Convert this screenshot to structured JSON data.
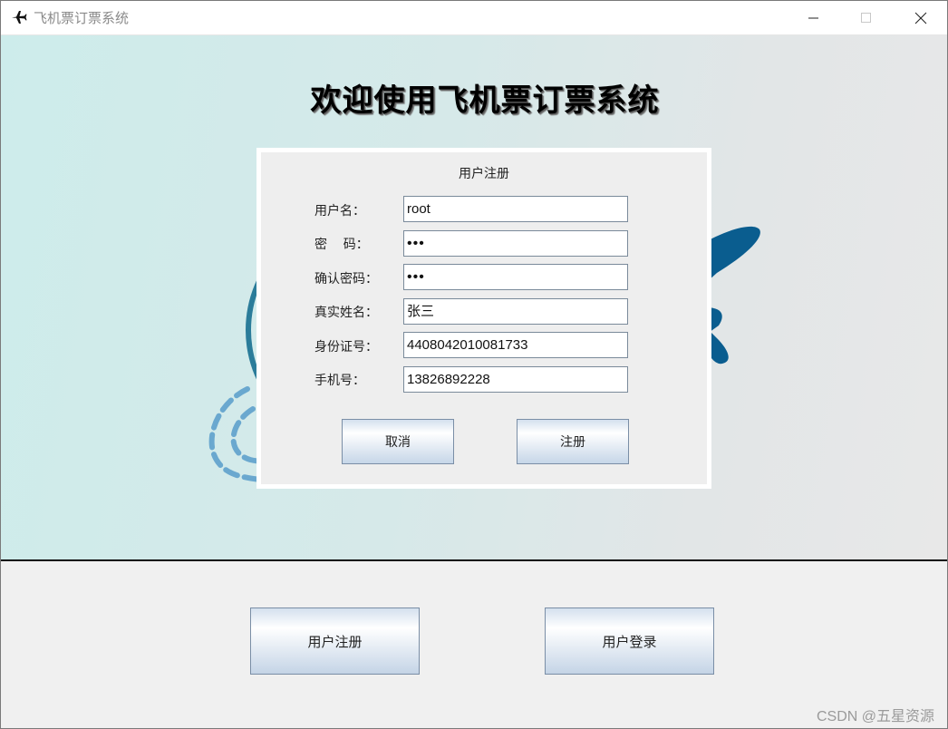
{
  "window": {
    "title": "飞机票订票系统",
    "icon": "airplane-icon"
  },
  "banner": {
    "heading": "欢迎使用飞机票订票系统"
  },
  "register_panel": {
    "title": "用户注册",
    "fields": [
      {
        "label": "用户名：",
        "value": "root"
      },
      {
        "label": "密    码：",
        "value": "•••"
      },
      {
        "label": "确认密码：",
        "value": "•••"
      },
      {
        "label": "真实姓名：",
        "value": "张三"
      },
      {
        "label": "身份证号：",
        "value": "4408042010081733"
      },
      {
        "label": "手机号：",
        "value": "13826892228"
      }
    ],
    "cancel_label": "取消",
    "submit_label": "注册"
  },
  "bottom": {
    "register_label": "用户注册",
    "login_label": "用户登录"
  },
  "watermark": "CSDN @五星资源",
  "colors": {
    "plane_blue": "#0a5d8f",
    "dash_blue": "#6aa8cf",
    "button_gradient_top": "#d4e0ee",
    "button_gradient_bottom": "#c6d6e8"
  }
}
